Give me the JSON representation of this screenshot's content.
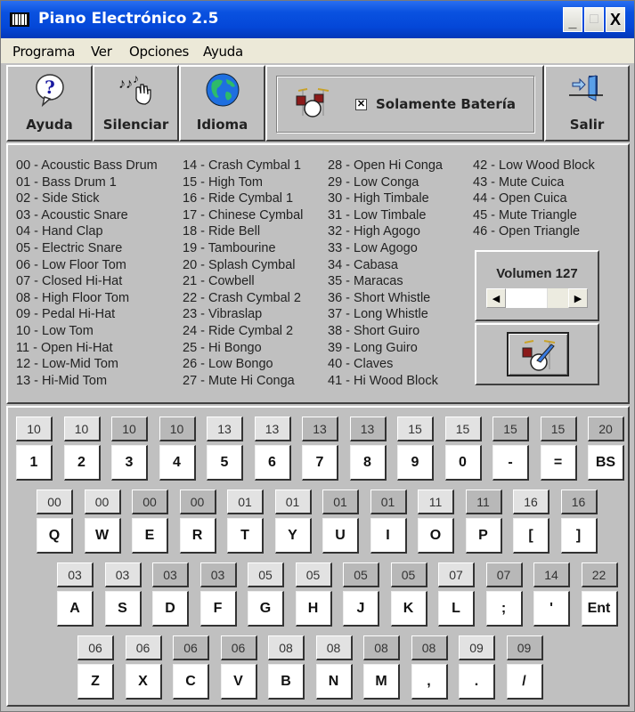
{
  "window": {
    "title": "Piano Electrónico 2.5",
    "controls": {
      "minimize": "_",
      "maximize": "□",
      "close": "X"
    }
  },
  "menu": [
    "Programa",
    "Ver",
    "Opciones",
    "Ayuda"
  ],
  "toolbar": {
    "ayuda": "Ayuda",
    "silenciar": "Silenciar",
    "idioma": "Idioma",
    "solamente_bateria": {
      "label": "Solamente Batería",
      "checked": true,
      "mark": "✕"
    },
    "salir": "Salir"
  },
  "instruments": {
    "col1": [
      "00 - Acoustic Bass Drum",
      "01 - Bass Drum 1",
      "02 - Side Stick",
      "03 - Acoustic Snare",
      "04 - Hand Clap",
      "05 - Electric Snare",
      "06 - Low Floor Tom",
      "07 - Closed Hi-Hat",
      "08 - High Floor Tom",
      "09 - Pedal Hi-Hat",
      "10 - Low Tom",
      "11 - Open Hi-Hat",
      "12 - Low-Mid Tom",
      "13 - Hi-Mid Tom"
    ],
    "col2": [
      "14 - Crash Cymbal 1",
      "15 - High Tom",
      "16 - Ride Cymbal 1",
      "17 - Chinese Cymbal",
      "18 - Ride Bell",
      "19 - Tambourine",
      "20 - Splash Cymbal",
      "21 - Cowbell",
      "22 - Crash Cymbal 2",
      "23 - Vibraslap",
      "24 - Ride Cymbal 2",
      "25 - Hi Bongo",
      "26 - Low Bongo",
      "27 - Mute Hi Conga"
    ],
    "col3": [
      "28 - Open Hi Conga",
      "29 - Low Conga",
      "30 - High Timbale",
      "31 - Low Timbale",
      "32 - High Agogo",
      "33 - Low Agogo",
      "34 - Cabasa",
      "35 - Maracas",
      "36 - Short Whistle",
      "37 - Long Whistle",
      "38 - Short Guiro",
      "39 - Long Guiro",
      "40 - Claves",
      "41 - Hi Wood Block"
    ],
    "col4": [
      "42 - Low Wood Block",
      "43 - Mute Cuica",
      "44 - Open Cuica",
      "45 - Mute Triangle",
      "46 - Open Triangle"
    ]
  },
  "volume": {
    "label": "Volumen 127",
    "value": 127,
    "max": 127,
    "left_arrow": "◀",
    "right_arrow": "▶"
  },
  "keyboard": {
    "rows": [
      {
        "labels": [
          "10",
          "10",
          "10",
          "10",
          "13",
          "13",
          "13",
          "13",
          "15",
          "15",
          "15",
          "15",
          "20"
        ],
        "shade": [
          "l",
          "l",
          "d",
          "d",
          "l",
          "l",
          "d",
          "d",
          "l",
          "l",
          "d",
          "d",
          "d"
        ],
        "keys": [
          "1",
          "2",
          "3",
          "4",
          "5",
          "6",
          "7",
          "8",
          "9",
          "0",
          "-",
          "=",
          "BS"
        ]
      },
      {
        "labels": [
          "00",
          "00",
          "00",
          "00",
          "01",
          "01",
          "01",
          "01",
          "11",
          "11",
          "16",
          "16"
        ],
        "shade": [
          "l",
          "l",
          "d",
          "d",
          "l",
          "l",
          "d",
          "d",
          "l",
          "d",
          "l",
          "d"
        ],
        "keys": [
          "Q",
          "W",
          "E",
          "R",
          "T",
          "Y",
          "U",
          "I",
          "O",
          "P",
          "[",
          "]"
        ]
      },
      {
        "labels": [
          "03",
          "03",
          "03",
          "03",
          "05",
          "05",
          "05",
          "05",
          "07",
          "07",
          "14",
          "22"
        ],
        "shade": [
          "l",
          "l",
          "d",
          "d",
          "l",
          "l",
          "d",
          "d",
          "l",
          "d",
          "d",
          "d"
        ],
        "keys": [
          "A",
          "S",
          "D",
          "F",
          "G",
          "H",
          "J",
          "K",
          "L",
          ";",
          "'",
          "Ent"
        ]
      },
      {
        "labels": [
          "06",
          "06",
          "06",
          "06",
          "08",
          "08",
          "08",
          "08",
          "09",
          "09"
        ],
        "shade": [
          "l",
          "l",
          "d",
          "d",
          "l",
          "l",
          "d",
          "d",
          "l",
          "d"
        ],
        "keys": [
          "Z",
          "X",
          "C",
          "V",
          "B",
          "N",
          "M",
          ",",
          ".",
          "/"
        ]
      }
    ]
  }
}
